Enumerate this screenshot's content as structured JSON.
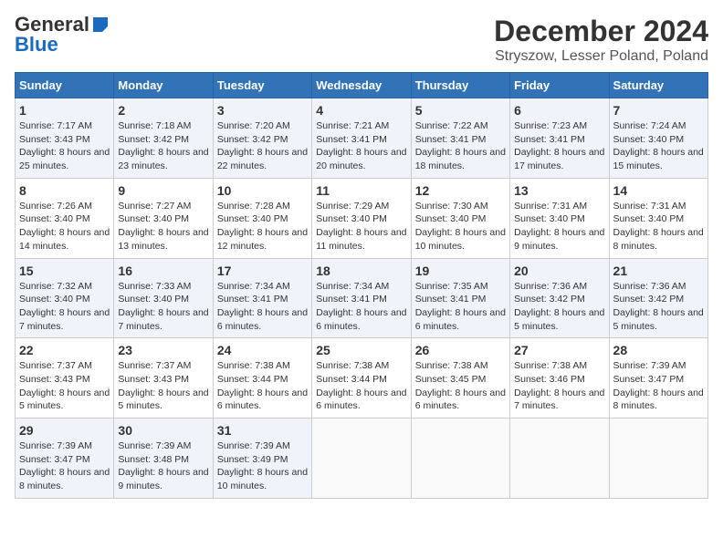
{
  "logo": {
    "general": "General",
    "blue": "Blue"
  },
  "title": "December 2024",
  "subtitle": "Stryszow, Lesser Poland, Poland",
  "days_header": [
    "Sunday",
    "Monday",
    "Tuesday",
    "Wednesday",
    "Thursday",
    "Friday",
    "Saturday"
  ],
  "weeks": [
    [
      {
        "day": "1",
        "sunrise": "7:17 AM",
        "sunset": "3:43 PM",
        "daylight": "8 hours and 25 minutes."
      },
      {
        "day": "2",
        "sunrise": "7:18 AM",
        "sunset": "3:42 PM",
        "daylight": "8 hours and 23 minutes."
      },
      {
        "day": "3",
        "sunrise": "7:20 AM",
        "sunset": "3:42 PM",
        "daylight": "8 hours and 22 minutes."
      },
      {
        "day": "4",
        "sunrise": "7:21 AM",
        "sunset": "3:41 PM",
        "daylight": "8 hours and 20 minutes."
      },
      {
        "day": "5",
        "sunrise": "7:22 AM",
        "sunset": "3:41 PM",
        "daylight": "8 hours and 18 minutes."
      },
      {
        "day": "6",
        "sunrise": "7:23 AM",
        "sunset": "3:41 PM",
        "daylight": "8 hours and 17 minutes."
      },
      {
        "day": "7",
        "sunrise": "7:24 AM",
        "sunset": "3:40 PM",
        "daylight": "8 hours and 15 minutes."
      }
    ],
    [
      {
        "day": "8",
        "sunrise": "7:26 AM",
        "sunset": "3:40 PM",
        "daylight": "8 hours and 14 minutes."
      },
      {
        "day": "9",
        "sunrise": "7:27 AM",
        "sunset": "3:40 PM",
        "daylight": "8 hours and 13 minutes."
      },
      {
        "day": "10",
        "sunrise": "7:28 AM",
        "sunset": "3:40 PM",
        "daylight": "8 hours and 12 minutes."
      },
      {
        "day": "11",
        "sunrise": "7:29 AM",
        "sunset": "3:40 PM",
        "daylight": "8 hours and 11 minutes."
      },
      {
        "day": "12",
        "sunrise": "7:30 AM",
        "sunset": "3:40 PM",
        "daylight": "8 hours and 10 minutes."
      },
      {
        "day": "13",
        "sunrise": "7:31 AM",
        "sunset": "3:40 PM",
        "daylight": "8 hours and 9 minutes."
      },
      {
        "day": "14",
        "sunrise": "7:31 AM",
        "sunset": "3:40 PM",
        "daylight": "8 hours and 8 minutes."
      }
    ],
    [
      {
        "day": "15",
        "sunrise": "7:32 AM",
        "sunset": "3:40 PM",
        "daylight": "8 hours and 7 minutes."
      },
      {
        "day": "16",
        "sunrise": "7:33 AM",
        "sunset": "3:40 PM",
        "daylight": "8 hours and 7 minutes."
      },
      {
        "day": "17",
        "sunrise": "7:34 AM",
        "sunset": "3:41 PM",
        "daylight": "8 hours and 6 minutes."
      },
      {
        "day": "18",
        "sunrise": "7:34 AM",
        "sunset": "3:41 PM",
        "daylight": "8 hours and 6 minutes."
      },
      {
        "day": "19",
        "sunrise": "7:35 AM",
        "sunset": "3:41 PM",
        "daylight": "8 hours and 6 minutes."
      },
      {
        "day": "20",
        "sunrise": "7:36 AM",
        "sunset": "3:42 PM",
        "daylight": "8 hours and 5 minutes."
      },
      {
        "day": "21",
        "sunrise": "7:36 AM",
        "sunset": "3:42 PM",
        "daylight": "8 hours and 5 minutes."
      }
    ],
    [
      {
        "day": "22",
        "sunrise": "7:37 AM",
        "sunset": "3:43 PM",
        "daylight": "8 hours and 5 minutes."
      },
      {
        "day": "23",
        "sunrise": "7:37 AM",
        "sunset": "3:43 PM",
        "daylight": "8 hours and 5 minutes."
      },
      {
        "day": "24",
        "sunrise": "7:38 AM",
        "sunset": "3:44 PM",
        "daylight": "8 hours and 6 minutes."
      },
      {
        "day": "25",
        "sunrise": "7:38 AM",
        "sunset": "3:44 PM",
        "daylight": "8 hours and 6 minutes."
      },
      {
        "day": "26",
        "sunrise": "7:38 AM",
        "sunset": "3:45 PM",
        "daylight": "8 hours and 6 minutes."
      },
      {
        "day": "27",
        "sunrise": "7:38 AM",
        "sunset": "3:46 PM",
        "daylight": "8 hours and 7 minutes."
      },
      {
        "day": "28",
        "sunrise": "7:39 AM",
        "sunset": "3:47 PM",
        "daylight": "8 hours and 8 minutes."
      }
    ],
    [
      {
        "day": "29",
        "sunrise": "7:39 AM",
        "sunset": "3:47 PM",
        "daylight": "8 hours and 8 minutes."
      },
      {
        "day": "30",
        "sunrise": "7:39 AM",
        "sunset": "3:48 PM",
        "daylight": "8 hours and 9 minutes."
      },
      {
        "day": "31",
        "sunrise": "7:39 AM",
        "sunset": "3:49 PM",
        "daylight": "8 hours and 10 minutes."
      },
      null,
      null,
      null,
      null
    ]
  ],
  "labels": {
    "sunrise": "Sunrise:",
    "sunset": "Sunset:",
    "daylight": "Daylight:"
  }
}
